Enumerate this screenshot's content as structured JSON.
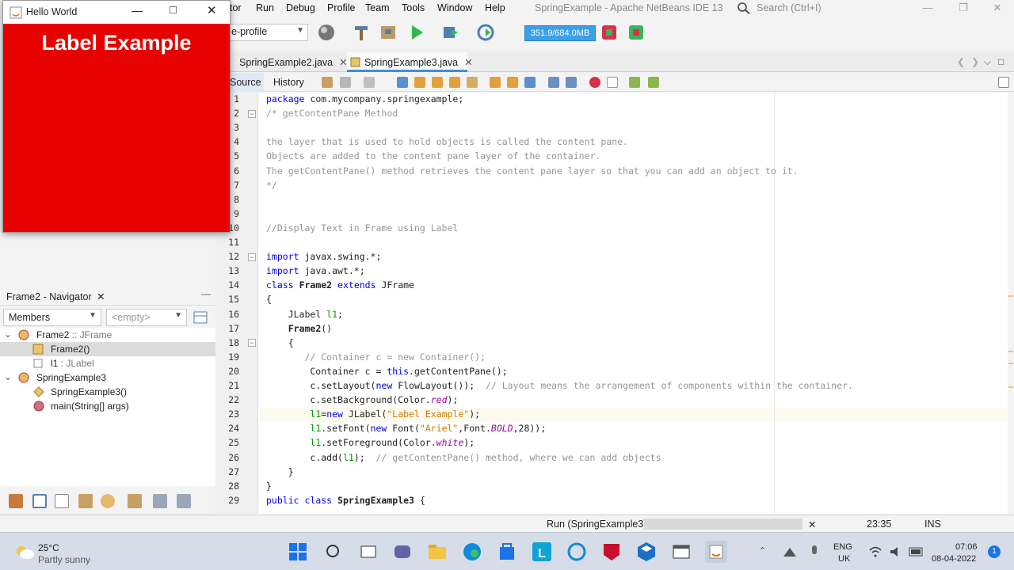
{
  "ide": {
    "menus": [
      "tor",
      "Run",
      "Debug",
      "Profile",
      "Team",
      "Tools",
      "Window",
      "Help"
    ],
    "window_title": "SpringExample - Apache NetBeans IDE 13",
    "search_placeholder": "Search (Ctrl+I)",
    "profile_select": "e-profile",
    "memory": "351.9/684.0MB",
    "tabs": [
      {
        "label": "SpringExample2.java",
        "active": false
      },
      {
        "label": "SpringExample3.java",
        "active": true
      }
    ],
    "editor_tabs": [
      "Source",
      "History"
    ],
    "code_lines": [
      "package com.mycompany.springexample;",
      "/* getContentPane Method",
      "",
      "the layer that is used to hold objects is called the content pane.",
      "Objects are added to the content pane layer of the container.",
      "The getContentPane() method retrieves the content pane layer so that you can add an object to it.",
      "*/",
      "",
      "",
      "//Display Text in Frame using Label",
      "",
      "import javax.swing.*;",
      "import java.awt.*;",
      "class Frame2 extends JFrame",
      "{",
      "    JLabel l1;",
      "    Frame2()",
      "    {",
      "       // Container c = new Container();",
      "        Container c = this.getContentPane();",
      "        c.setLayout(new FlowLayout());  // Layout means the arrangement of components within the container.",
      "        c.setBackground(Color.red);",
      "        l1=new JLabel(\"Label Example\");",
      "        l1.setFont(new Font(\"Ariel\",Font.BOLD,28));",
      "        l1.setForeground(Color.white);",
      "        c.add(l1);  // getContentPane() method, where we can add objects",
      "    }",
      "}",
      "public class SpringExample3 {"
    ],
    "navigator": {
      "title": "Frame2 - Navigator",
      "filter": "Members",
      "empty": "<empty>",
      "tree": [
        {
          "label": "Frame2",
          "type": " :: JFrame",
          "level": 0,
          "selected": false
        },
        {
          "label": "Frame2()",
          "type": "",
          "level": 1,
          "selected": true
        },
        {
          "label": "l1",
          "type": " : JLabel",
          "level": 1,
          "selected": false
        },
        {
          "label": "SpringExample3",
          "type": "",
          "level": 0,
          "selected": false
        },
        {
          "label": "SpringExample3()",
          "type": "",
          "level": 1,
          "selected": false
        },
        {
          "label": "main(String[] args)",
          "type": "",
          "level": 1,
          "selected": false
        }
      ]
    },
    "status": {
      "run": "Run (SpringExample3)",
      "position": "23:35",
      "mode": "INS"
    }
  },
  "hello_frame": {
    "title": "Hello World",
    "label": "Label Example",
    "background": "#e60000"
  },
  "taskbar": {
    "temperature": "25°C",
    "weather": "Partly sunny",
    "lang1": "ENG",
    "lang2": "UK",
    "time": "07:06",
    "date": "08-04-2022",
    "notifications": "1"
  }
}
